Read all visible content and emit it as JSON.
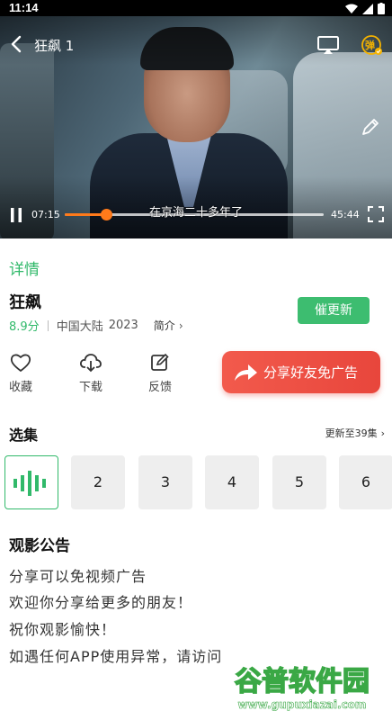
{
  "status_bar": {
    "time": "11:14"
  },
  "player": {
    "title": "狂飙 1",
    "subtitle": "在京海二十多年了",
    "current_time": "07:15",
    "total_time": "45:44",
    "progress": 0.158,
    "danmaku_label": "弹",
    "accent_color": "#ff7a1a"
  },
  "details": {
    "tab_label": "详情",
    "title": "狂飙",
    "score": "8.9分",
    "region": "中国大陆",
    "year": "2023",
    "intro_label": "简介",
    "urge_update_label": "催更新"
  },
  "actions": {
    "favorite": "收藏",
    "download": "下载",
    "feedback": "反馈",
    "share": "分享好友免广告"
  },
  "episodes": {
    "header": "选集",
    "update_status": "更新至39集",
    "items": [
      "2",
      "3",
      "4",
      "5",
      "6"
    ],
    "accent_color": "#31b96a"
  },
  "notice": {
    "title": "观影公告",
    "lines": [
      "分享可以免视频广告",
      "欢迎你分享给更多的朋友！",
      "祝你观影愉快！",
      "如遇任何APP使用异常，请访问"
    ]
  },
  "watermark": {
    "main": "谷普软件园",
    "sub": "www.gupuxiazai.com"
  }
}
